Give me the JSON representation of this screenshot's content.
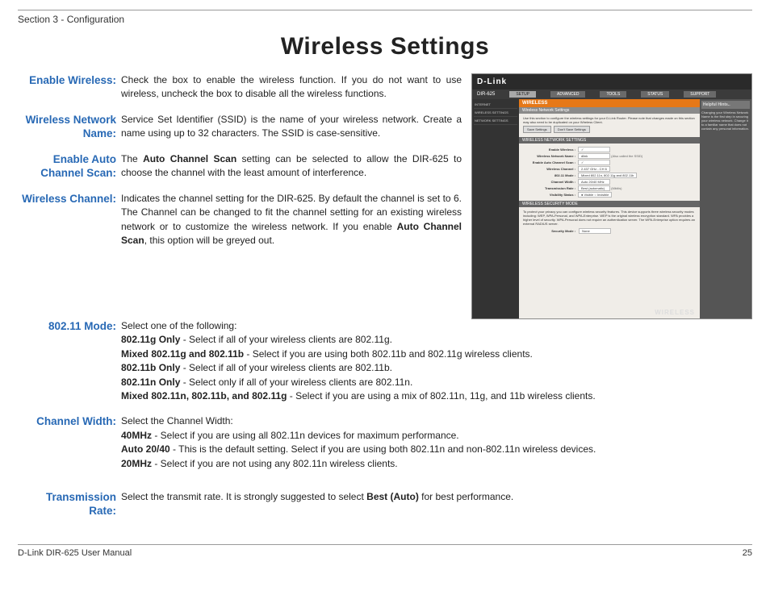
{
  "header": {
    "section": "Section 3 - Configuration"
  },
  "title": "Wireless Settings",
  "rows": {
    "enable_wireless": {
      "label": "Enable Wireless:",
      "text": "Check the box to enable the wireless function. If you do not want to use wireless, uncheck the box to disable all the wireless functions."
    },
    "ssid": {
      "label": "Wireless Network Name:",
      "text": "Service Set Identifier (SSID) is the name of your wireless network. Create a name using up to 32 characters. The SSID is case-sensitive."
    },
    "auto_scan": {
      "label": "Enable Auto Channel Scan:",
      "pre": "The ",
      "bold": "Auto Channel Scan",
      "post": " setting can be selected to allow the DIR-625 to choose the channel with the least amount of interference."
    },
    "channel": {
      "label": "Wireless Channel:",
      "pre": "Indicates the channel setting for the DIR-625. By default the channel is set to 6. The Channel can be changed to fit the channel setting for an existing wireless network or to customize the wireless network. If you enable ",
      "bold": "Auto Channel Scan",
      "post": ", this option will be greyed out."
    },
    "mode": {
      "label": "802.11 Mode:",
      "intro": "Select one of the following:",
      "opts": [
        {
          "b": "802.11g Only",
          "t": " - Select if all of your wireless clients are 802.11g."
        },
        {
          "b": "Mixed 802.11g and 802.11b",
          "t": " - Select if you are using both 802.11b and 802.11g wireless clients."
        },
        {
          "b": "802.11b Only",
          "t": " - Select if all of your wireless clients are 802.11b."
        },
        {
          "b": "802.11n Only",
          "t": " - Select only if all of your wireless clients are 802.11n."
        },
        {
          "b": "Mixed 802.11n, 802.11b, and 802.11g",
          "t": " - Select if you are using a mix of 802.11n, 11g, and 11b wireless clients."
        }
      ]
    },
    "width": {
      "label": "Channel Width:",
      "intro": "Select the Channel Width:",
      "opts": [
        {
          "b": "40MHz",
          "t": " - Select if you are using all 802.11n devices for maximum performance."
        },
        {
          "b": "Auto 20/40",
          "t": " - This is the default setting. Select if you are using both 802.11n and non-802.11n wireless devices."
        },
        {
          "b": "20MHz",
          "t": " - Select if you are not using any 802.11n wireless clients."
        }
      ]
    },
    "rate": {
      "label": "Transmission Rate:",
      "pre": "Select the transmit rate. It is strongly suggested to select ",
      "bold": "Best (Auto)",
      "post": " for best performance."
    }
  },
  "screenshot": {
    "brand": "D-Link",
    "model": "DIR-625",
    "tabs": [
      "SETUP",
      "ADVANCED",
      "TOOLS",
      "STATUS",
      "SUPPORT"
    ],
    "side": [
      "INTERNET",
      "WIRELESS SETTINGS",
      "NETWORK SETTINGS"
    ],
    "bar": "WIRELESS",
    "sub1": "Wireless Network Settings",
    "intro": "Use this section to configure the wireless settings for your D-Link Router. Please note that changes made on this section may also need to be duplicated on your Wireless Client.",
    "btn_save": "Save Settings",
    "btn_cancel": "Don't Save Settings",
    "sec1": "WIRELESS NETWORK SETTINGS",
    "fields": [
      {
        "l": "Enable Wireless :",
        "v": "✓"
      },
      {
        "l": "Wireless Network Name :",
        "v": "dlink",
        "note": "(Also called the SSID)"
      },
      {
        "l": "Enable Auto Channel Scan :",
        "v": "✓"
      },
      {
        "l": "Wireless Channel :",
        "v": "2.437 GHz - CH 6"
      },
      {
        "l": "802.11 Mode :",
        "v": "Mixed 802.11n, 802.11g and 802.11b"
      },
      {
        "l": "Channel Width :",
        "v": "Auto 20/40 MHz"
      },
      {
        "l": "Transmission Rate :",
        "v": "Best (automatic)",
        "note": "(Mbit/s)"
      },
      {
        "l": "Visibility Status :",
        "v": "● Visible  ○ Invisible"
      }
    ],
    "sec2": "WIRELESS SECURITY MODE",
    "sec2text": "To protect your privacy you can configure wireless security features. This device supports three wireless security modes including: WEP, WPA-Personal, and WPA-Enterprise. WEP is the original wireless encryption standard. WPA provides a higher level of security. WPA-Personal does not require an authentication server. The WPA-Enterprise option requires an external RADIUS server.",
    "secmode": {
      "l": "Security Mode :",
      "v": "None"
    },
    "foot": "WIRELESS",
    "help_title": "Helpful Hints..",
    "help_text": "Changing your Wireless Network Name is the first step in securing your wireless network. Change it to a familiar name that does not contain any personal information."
  },
  "footer": {
    "left": "D-Link DIR-625 User Manual",
    "right": "25"
  }
}
